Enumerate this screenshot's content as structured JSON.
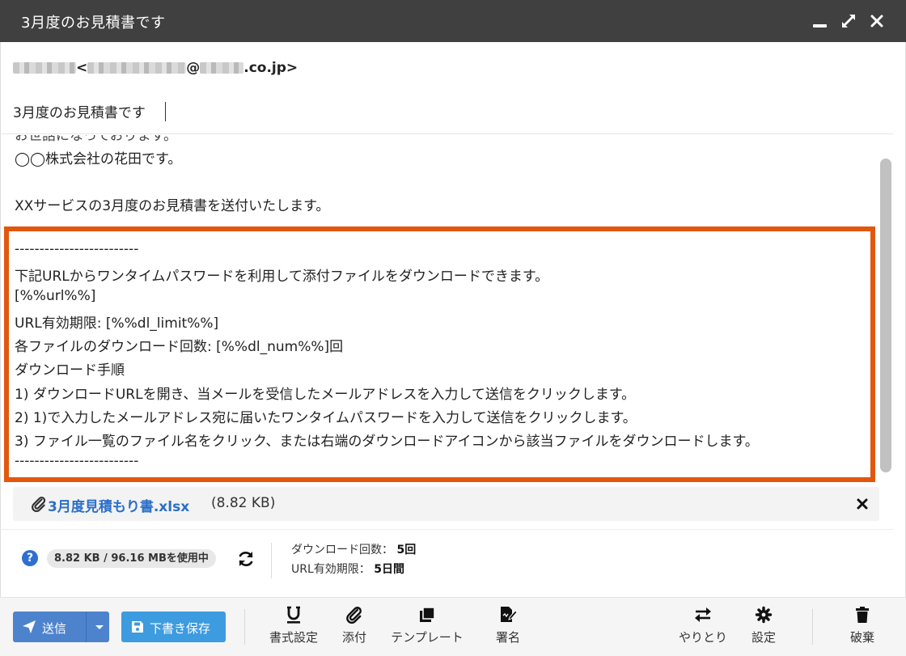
{
  "window": {
    "title": "3月度のお見積書です"
  },
  "to": {
    "lt": "<",
    "at": "@",
    "domain_suffix": ".co.jp>"
  },
  "subject": {
    "value": "3月度のお見積書です"
  },
  "body": {
    "clipped_top": "お世話になっております。",
    "lines": [
      "◯◯株式会社の花田です。",
      "",
      "XXサービスの3月度のお見積書を送付いたします。",
      "",
      "-------------------------",
      "下記URLからワンタイムパスワードを利用して添付ファイルをダウンロードできます。",
      "[%%url%%]",
      "URL有効期限: [%%dl_limit%%]",
      "各ファイルのダウンロード回数: [%%dl_num%%]回",
      "ダウンロード手順",
      "1) ダウンロードURLを開き、当メールを受信したメールアドレスを入力して送信をクリックします。",
      "2) 1)で入力したメールアドレス宛に届いたワンタイムパスワードを入力して送信をクリックします。",
      "3) ファイル一覧のファイル名をクリック、または右端のダウンロードアイコンから該当ファイルをダウンロードします。",
      "-------------------------"
    ]
  },
  "attachment": {
    "name": "3月度見積もり書.xlsx",
    "size": "(8.82 KB)"
  },
  "usage": {
    "help": "?",
    "badge": "8.82 KB / 96.16 MBを使用中",
    "download_count_label": "ダウンロード回数：",
    "download_count_value": "5回",
    "url_limit_label": "URL有効期限：",
    "url_limit_value": "5日間"
  },
  "toolbar": {
    "send": "送信",
    "save_draft": "下書き保存",
    "format": "書式設定",
    "attach": "添付",
    "template": "テンプレート",
    "signature": "署名",
    "thread": "やりとり",
    "settings": "設定",
    "discard": "破棄"
  },
  "colors": {
    "titlebar": "#404040",
    "highlight": "#e2570e",
    "send_button": "#4d83cd",
    "draft_button": "#3d9be0",
    "link": "#2a6fc9"
  }
}
